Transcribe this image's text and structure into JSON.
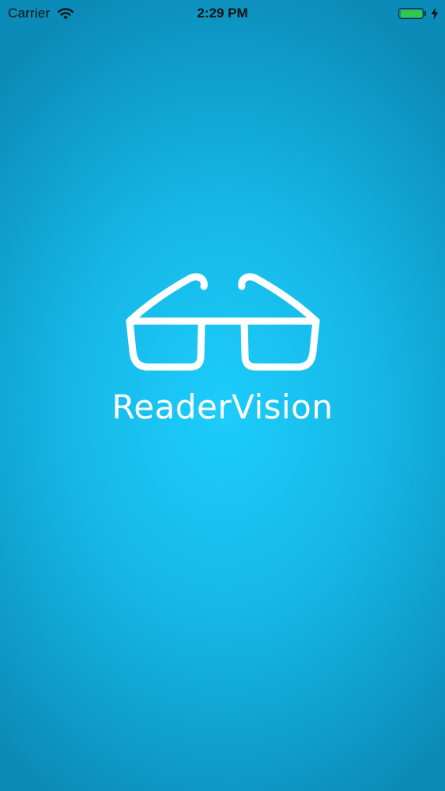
{
  "status_bar": {
    "carrier": "Carrier",
    "time": "2:29 PM",
    "battery_level": 1.0,
    "icons": [
      "wifi-icon",
      "battery-icon",
      "charging-icon"
    ]
  },
  "splash": {
    "app_name": "ReaderVision",
    "logo_icon": "glasses-icon"
  },
  "colors": {
    "background_center": "#1ccdfc",
    "background_edge": "#0b8bb8",
    "logo": "#ffffff",
    "battery_fill": "#2ecb44"
  }
}
